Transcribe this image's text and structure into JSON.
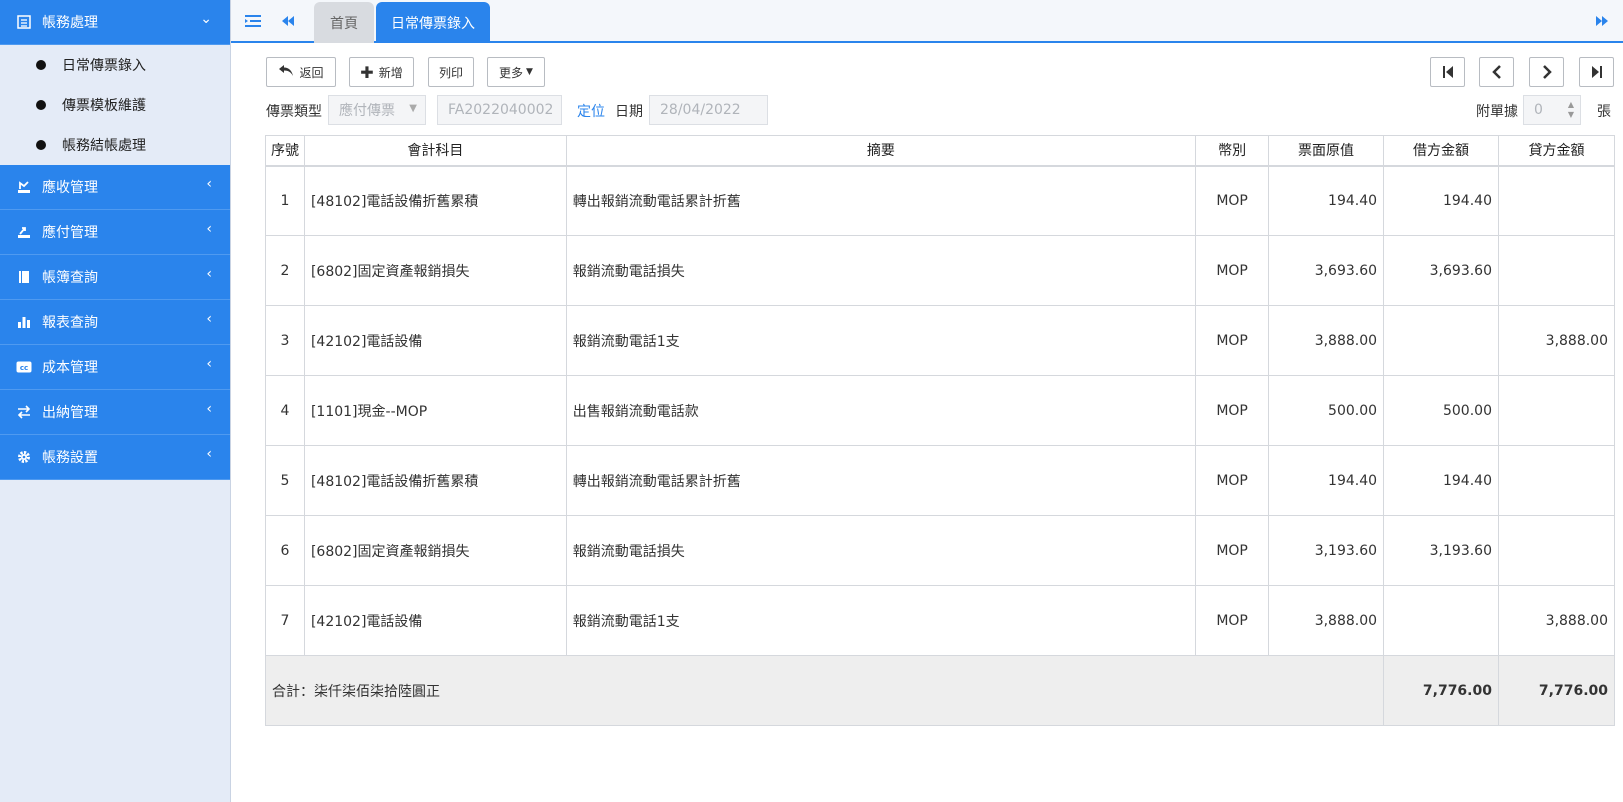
{
  "sidebar": {
    "groups": [
      {
        "label": "帳務處理",
        "icon": "list-icon",
        "expanded": true
      },
      {
        "label": "應收管理",
        "icon": "receive-icon"
      },
      {
        "label": "應付管理",
        "icon": "pay-icon"
      },
      {
        "label": "帳簿查詢",
        "icon": "book-icon"
      },
      {
        "label": "報表查詢",
        "icon": "bar-chart-icon"
      },
      {
        "label": "成本管理",
        "icon": "cc-icon"
      },
      {
        "label": "出納管理",
        "icon": "exchange-icon"
      },
      {
        "label": "帳務設置",
        "icon": "gear-icon"
      }
    ],
    "sub_items": [
      "日常傳票錄入",
      "傳票模板維護",
      "帳務結帳處理"
    ]
  },
  "tabs": {
    "home": "首頁",
    "active": "日常傳票錄入"
  },
  "toolbar": {
    "back": "返回",
    "add": "新增",
    "print": "列印",
    "more": "更多"
  },
  "form": {
    "voucher_type_label": "傳票類型",
    "voucher_type_value": "應付傳票",
    "voucher_no": "FA2022040002",
    "locate": "定位",
    "date_label": "日期",
    "date_value": "28/04/2022",
    "attach_label": "附單據",
    "attach_value": "0",
    "attach_unit": "張"
  },
  "table": {
    "headers": [
      "序號",
      "會計科目",
      "摘要",
      "幣別",
      "票面原值",
      "借方金額",
      "貸方金額"
    ],
    "rows": [
      [
        "1",
        "[48102]電話設備折舊累積",
        "轉出報銷流動電話累計折舊",
        "MOP",
        "194.40",
        "194.40",
        ""
      ],
      [
        "2",
        "[6802]固定資產報銷損失",
        "報銷流動電話損失",
        "MOP",
        "3,693.60",
        "3,693.60",
        ""
      ],
      [
        "3",
        "[42102]電話設備",
        "報銷流動電話1支",
        "MOP",
        "3,888.00",
        "",
        "3,888.00"
      ],
      [
        "4",
        "[1101]現金--MOP",
        "出售報銷流動電話款",
        "MOP",
        "500.00",
        "500.00",
        ""
      ],
      [
        "5",
        "[48102]電話設備折舊累積",
        "轉出報銷流動電話累計折舊",
        "MOP",
        "194.40",
        "194.40",
        ""
      ],
      [
        "6",
        "[6802]固定資產報銷損失",
        "報銷流動電話損失",
        "MOP",
        "3,193.60",
        "3,193.60",
        ""
      ],
      [
        "7",
        "[42102]電話設備",
        "報銷流動電話1支",
        "MOP",
        "3,888.00",
        "",
        "3,888.00"
      ]
    ],
    "total_label": "合計：柒仟柒佰柒拾陸圓正",
    "total_debit": "7,776.00",
    "total_credit": "7,776.00"
  }
}
